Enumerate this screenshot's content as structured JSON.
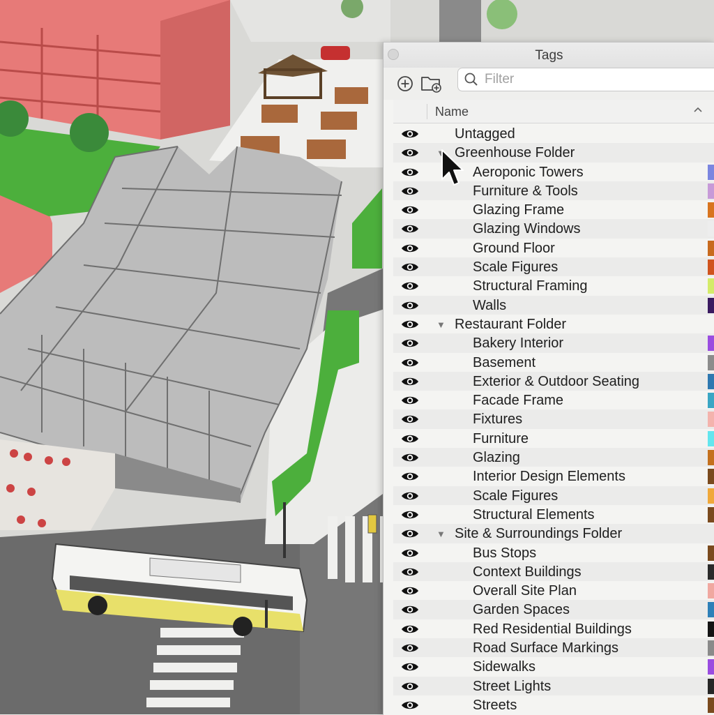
{
  "panel": {
    "title": "Tags",
    "filter_placeholder": "Filter",
    "column_name": "Name"
  },
  "icons": {
    "add": "plus-circle-icon",
    "add_folder": "folder-plus-icon",
    "search": "magnifier-icon",
    "visibility": "eye-icon",
    "sort": "chevron-up-icon",
    "disclosure": "triangle-down-icon"
  },
  "tags": [
    {
      "label": "Untagged",
      "type": "tag",
      "level": 0,
      "color": null
    },
    {
      "label": "Greenhouse Folder",
      "type": "folder",
      "level": 0,
      "expanded": true,
      "color": null
    },
    {
      "label": "Aeroponic Towers",
      "type": "tag",
      "level": 1,
      "color": "#7b86e0"
    },
    {
      "label": "Furniture & Tools",
      "type": "tag",
      "level": 1,
      "color": "#c79ad8"
    },
    {
      "label": "Glazing Frame",
      "type": "tag",
      "level": 1,
      "color": "#d8741f"
    },
    {
      "label": "Glazing Windows",
      "type": "tag",
      "level": 1,
      "color": "#ededed"
    },
    {
      "label": "Ground Floor",
      "type": "tag",
      "level": 1,
      "color": "#c86a1e"
    },
    {
      "label": "Scale Figures",
      "type": "tag",
      "level": 1,
      "color": "#d0531e"
    },
    {
      "label": "Structural Framing",
      "type": "tag",
      "level": 1,
      "color": "#d4eb6a"
    },
    {
      "label": "Walls",
      "type": "tag",
      "level": 1,
      "color": "#3a1a60"
    },
    {
      "label": "Restaurant Folder",
      "type": "folder",
      "level": 0,
      "expanded": true,
      "color": null
    },
    {
      "label": "Bakery Interior",
      "type": "tag",
      "level": 1,
      "color": "#9a4de0"
    },
    {
      "label": "Basement",
      "type": "tag",
      "level": 1,
      "color": "#8c8c8c"
    },
    {
      "label": "Exterior & Outdoor Seating",
      "type": "tag",
      "level": 1,
      "color": "#2e78b0"
    },
    {
      "label": "Facade Frame",
      "type": "tag",
      "level": 1,
      "color": "#3aa6c4"
    },
    {
      "label": "Fixtures",
      "type": "tag",
      "level": 1,
      "color": "#f4b3ad"
    },
    {
      "label": "Furniture",
      "type": "tag",
      "level": 1,
      "color": "#63e6ee"
    },
    {
      "label": "Glazing",
      "type": "tag",
      "level": 1,
      "color": "#c4701e"
    },
    {
      "label": "Interior Design Elements",
      "type": "tag",
      "level": 1,
      "color": "#7a4a1e"
    },
    {
      "label": "Scale Figures",
      "type": "tag",
      "level": 1,
      "color": "#f0a83a"
    },
    {
      "label": "Structural Elements",
      "type": "tag",
      "level": 1,
      "color": "#7a4a1e"
    },
    {
      "label": "Site & Surroundings Folder",
      "type": "folder",
      "level": 0,
      "expanded": true,
      "color": null
    },
    {
      "label": "Bus Stops",
      "type": "tag",
      "level": 1,
      "color": "#7a4a1e"
    },
    {
      "label": "Context Buildings",
      "type": "tag",
      "level": 1,
      "color": "#2a2a2a"
    },
    {
      "label": "Overall Site Plan",
      "type": "tag",
      "level": 1,
      "color": "#f0a8a0"
    },
    {
      "label": "Garden Spaces",
      "type": "tag",
      "level": 1,
      "color": "#2e80b8"
    },
    {
      "label": "Red Residential Buildings",
      "type": "tag",
      "level": 1,
      "color": "#141414"
    },
    {
      "label": "Road Surface Markings",
      "type": "tag",
      "level": 1,
      "color": "#8a8a8a"
    },
    {
      "label": "Sidewalks",
      "type": "tag",
      "level": 1,
      "color": "#9a4de0"
    },
    {
      "label": "Street Lights",
      "type": "tag",
      "level": 1,
      "color": "#262626"
    },
    {
      "label": "Streets",
      "type": "tag",
      "level": 1,
      "color": "#7a4a1e"
    }
  ]
}
